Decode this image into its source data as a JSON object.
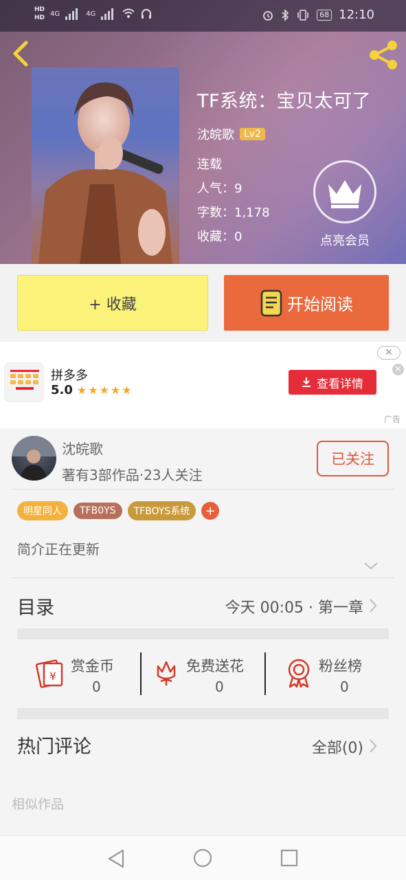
{
  "status_bar": {
    "hd1": "HD",
    "hd2": "HD",
    "net1": "4G",
    "net2": "4G",
    "battery": "68",
    "time": "12:10"
  },
  "book": {
    "title": "TF系统：宝贝太可了",
    "author": "沈皖歌",
    "level": "Lv2",
    "status": "连载",
    "popularity": "人气：9",
    "word_count": "字数：1,178",
    "favorites": "收藏：0",
    "vip_label": "点亮会员"
  },
  "actions": {
    "collect": "+ 收藏",
    "read": "开始阅读"
  },
  "ad": {
    "app_name": "拼多多",
    "rating": "5.0",
    "stars": "★★★★★",
    "cta": "查看详情",
    "tag": "广告",
    "close": "✕"
  },
  "author_card": {
    "name": "沈皖歌",
    "stats": "著有3部作品·23人关注",
    "follow": "已关注"
  },
  "tags": [
    "明星同人",
    "TFB0YS",
    "TFBOYS系统"
  ],
  "tag_colors": [
    "#f3b23e",
    "#b8705d",
    "#c99a3c"
  ],
  "intro": "简介正在更新",
  "toc": {
    "title": "目录",
    "latest": "今天 00:05 · 第一章"
  },
  "stats": [
    {
      "label": "赏金币",
      "value": "0",
      "icon": "red-envelope-icon"
    },
    {
      "label": "免费送花",
      "value": "0",
      "icon": "flower-icon"
    },
    {
      "label": "粉丝榜",
      "value": "0",
      "icon": "medal-icon"
    }
  ],
  "comments": {
    "title": "热门评论",
    "all": "全部(0)"
  },
  "similar": "相似作品",
  "colors": {
    "accent": "#ea6a3d",
    "collect": "#fbf27a",
    "follow": "#e0553a",
    "ad_button": "#e52d3a"
  }
}
